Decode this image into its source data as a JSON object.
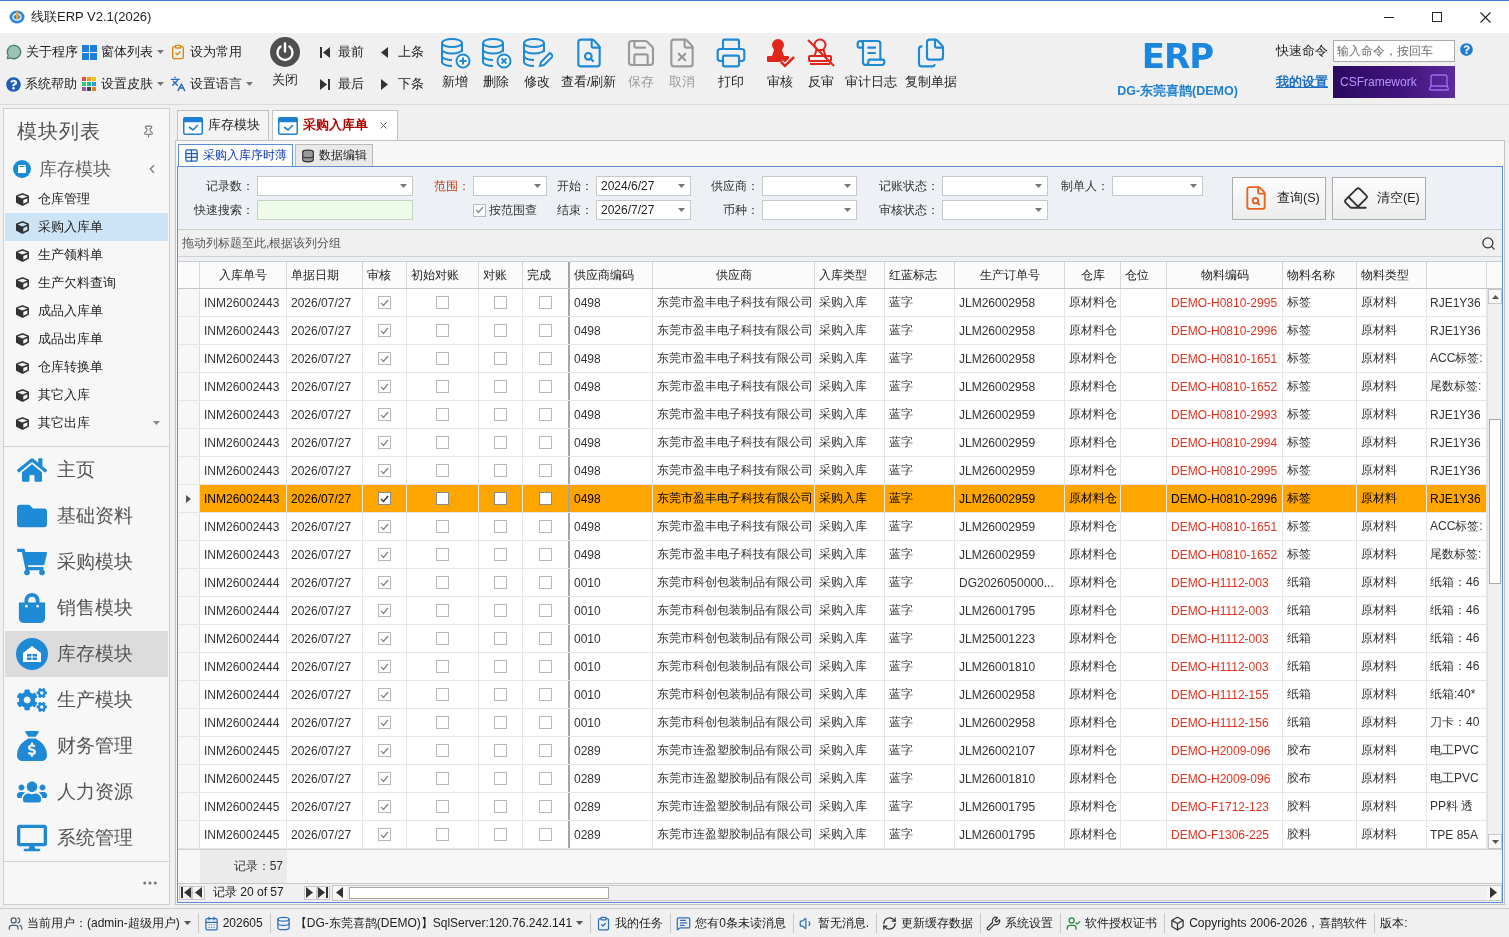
{
  "window": {
    "title": "线联ERP V2.1(2026)"
  },
  "toolbar": {
    "small_buttons": [
      {
        "label": "关于程序",
        "dropdown": false
      },
      {
        "label": "窗体列表",
        "dropdown": true
      },
      {
        "label": "设为常用",
        "dropdown": false
      },
      {
        "label": "系统帮助",
        "dropdown": false
      },
      {
        "label": "设置皮肤",
        "dropdown": true
      },
      {
        "label": "设置语言",
        "dropdown": true
      }
    ],
    "close_button": {
      "label": "关闭"
    },
    "nav_buttons": [
      {
        "label": "最前"
      },
      {
        "label": "上条"
      },
      {
        "label": "最后"
      },
      {
        "label": "下条"
      }
    ],
    "action_groups": [
      [
        {
          "label": "新增",
          "disabled": false
        },
        {
          "label": "删除",
          "disabled": false
        },
        {
          "label": "修改",
          "disabled": false
        },
        {
          "label": "查看/刷新",
          "disabled": false
        },
        {
          "label": "保存",
          "disabled": true
        },
        {
          "label": "取消",
          "disabled": true
        }
      ],
      [
        {
          "label": "打印",
          "disabled": false
        }
      ],
      [
        {
          "label": "审核",
          "disabled": false
        },
        {
          "label": "反审",
          "disabled": false
        },
        {
          "label": "审计日志",
          "disabled": false
        },
        {
          "label": "复制单据",
          "disabled": false
        }
      ]
    ],
    "logo": {
      "text": "ERP",
      "caption": "DG-东莞喜鹊(DEMO)"
    },
    "quick_command": {
      "label": "快速命令",
      "placeholder": "输入命令，按回车"
    },
    "settings_link": "我的设置",
    "banner": {
      "text": "CSFramework"
    }
  },
  "sidebar": {
    "title": "模块列表",
    "module": "库存模块",
    "items": [
      {
        "label": "仓库管理",
        "selected": false
      },
      {
        "label": "采购入库单",
        "selected": true
      },
      {
        "label": "生产领料单",
        "selected": false
      },
      {
        "label": "生产欠料查询",
        "selected": false
      },
      {
        "label": "成品入库单",
        "selected": false
      },
      {
        "label": "成品出库单",
        "selected": false
      },
      {
        "label": "仓库转换单",
        "selected": false
      },
      {
        "label": "其它入库",
        "selected": false
      },
      {
        "label": "其它出库",
        "selected": false
      }
    ],
    "groups": [
      {
        "label": "主页",
        "selected": false
      },
      {
        "label": "基础资料",
        "selected": false
      },
      {
        "label": "采购模块",
        "selected": false
      },
      {
        "label": "销售模块",
        "selected": false
      },
      {
        "label": "库存模块",
        "selected": true
      },
      {
        "label": "生产模块",
        "selected": false
      },
      {
        "label": "财务管理",
        "selected": false
      },
      {
        "label": "人力资源",
        "selected": false
      },
      {
        "label": "系统管理",
        "selected": false
      }
    ]
  },
  "tabs": [
    {
      "label": "库存模块",
      "selected": false,
      "closable": false
    },
    {
      "label": "采购入库单",
      "selected": true,
      "closable": true
    }
  ],
  "sub_tabs": [
    {
      "label": "采购入库序时薄",
      "selected": true
    },
    {
      "label": "数据编辑",
      "selected": false
    }
  ],
  "filters": {
    "rows": [
      [
        {
          "kind": "combo",
          "label": "记录数：",
          "highlight": false
        },
        {
          "kind": "combo",
          "label": "范围：",
          "highlight": true
        },
        {
          "kind": "combo",
          "label": "开始：",
          "value": "2024/6/27",
          "highlight": false
        },
        {
          "kind": "combo",
          "label": "供应商：",
          "highlight": false
        },
        {
          "kind": "combo",
          "label": "记账状态：",
          "highlight": false
        },
        {
          "kind": "combo",
          "label": "制单人：",
          "highlight": false
        }
      ],
      [
        {
          "kind": "input",
          "label": "快速搜索：",
          "highlight": false
        },
        {
          "kind": "checkbox",
          "label": "按范围查",
          "checked": true
        },
        {
          "kind": "combo",
          "label": "结束：",
          "value": "2026/7/27",
          "highlight": false
        },
        {
          "kind": "combo",
          "label": "币种：",
          "highlight": false
        },
        {
          "kind": "combo",
          "label": "审核状态：",
          "highlight": false
        }
      ]
    ],
    "buttons": [
      {
        "label": "查询(S)"
      },
      {
        "label": "清空(E)"
      }
    ]
  },
  "group_panel": {
    "hint": "拖动列标题至此,根据该列分组"
  },
  "table": {
    "columns": [
      {
        "label": "入库单号",
        "kind": "text"
      },
      {
        "label": "单据日期",
        "kind": "text"
      },
      {
        "label": "审核",
        "kind": "check"
      },
      {
        "label": "初始对账",
        "kind": "check"
      },
      {
        "label": "对账",
        "kind": "check"
      },
      {
        "label": "完成",
        "kind": "check"
      },
      {
        "label": "供应商编码",
        "kind": "text"
      },
      {
        "label": "供应商",
        "kind": "text"
      },
      {
        "label": "入库类型",
        "kind": "text"
      },
      {
        "label": "红蓝标志",
        "kind": "text"
      },
      {
        "label": "生产订单号",
        "kind": "text"
      },
      {
        "label": "仓库",
        "kind": "text"
      },
      {
        "label": "仓位",
        "kind": "text"
      },
      {
        "label": "物料编码",
        "kind": "code"
      },
      {
        "label": "物料名称",
        "kind": "text"
      },
      {
        "label": "物料类型",
        "kind": "text"
      },
      {
        "kind": "text"
      }
    ],
    "rows": [
      {
        "selected": false,
        "cells": [
          "INM26002443",
          "2026/07/27",
          {
            "checked": true
          },
          {
            "checked": false
          },
          {
            "checked": false
          },
          {
            "checked": false
          },
          "0498",
          "东莞市盈丰电子科技有限公司",
          "采购入库",
          "蓝字",
          "JLM26002958",
          "原材料仓",
          null,
          "DEMO-H0810-2995",
          "标签",
          "原材料",
          "RJE1Y36"
        ]
      },
      {
        "selected": false,
        "cells": [
          "INM26002443",
          "2026/07/27",
          {
            "checked": true
          },
          {
            "checked": false
          },
          {
            "checked": false
          },
          {
            "checked": false
          },
          "0498",
          "东莞市盈丰电子科技有限公司",
          "采购入库",
          "蓝字",
          "JLM26002958",
          "原材料仓",
          null,
          "DEMO-H0810-2996",
          "标签",
          "原材料",
          "RJE1Y36"
        ]
      },
      {
        "selected": false,
        "cells": [
          "INM26002443",
          "2026/07/27",
          {
            "checked": true
          },
          {
            "checked": false
          },
          {
            "checked": false
          },
          {
            "checked": false
          },
          "0498",
          "东莞市盈丰电子科技有限公司",
          "采购入库",
          "蓝字",
          "JLM26002958",
          "原材料仓",
          null,
          "DEMO-H0810-1651",
          "标签",
          "原材料",
          "ACC标签:"
        ]
      },
      {
        "selected": false,
        "cells": [
          "INM26002443",
          "2026/07/27",
          {
            "checked": true
          },
          {
            "checked": false
          },
          {
            "checked": false
          },
          {
            "checked": false
          },
          "0498",
          "东莞市盈丰电子科技有限公司",
          "采购入库",
          "蓝字",
          "JLM26002958",
          "原材料仓",
          null,
          "DEMO-H0810-1652",
          "标签",
          "原材料",
          "尾数标签:"
        ]
      },
      {
        "selected": false,
        "cells": [
          "INM26002443",
          "2026/07/27",
          {
            "checked": true
          },
          {
            "checked": false
          },
          {
            "checked": false
          },
          {
            "checked": false
          },
          "0498",
          "东莞市盈丰电子科技有限公司",
          "采购入库",
          "蓝字",
          "JLM26002959",
          "原材料仓",
          null,
          "DEMO-H0810-2993",
          "标签",
          "原材料",
          "RJE1Y36"
        ]
      },
      {
        "selected": false,
        "cells": [
          "INM26002443",
          "2026/07/27",
          {
            "checked": true
          },
          {
            "checked": false
          },
          {
            "checked": false
          },
          {
            "checked": false
          },
          "0498",
          "东莞市盈丰电子科技有限公司",
          "采购入库",
          "蓝字",
          "JLM26002959",
          "原材料仓",
          null,
          "DEMO-H0810-2994",
          "标签",
          "原材料",
          "RJE1Y36"
        ]
      },
      {
        "selected": false,
        "cells": [
          "INM26002443",
          "2026/07/27",
          {
            "checked": true
          },
          {
            "checked": false
          },
          {
            "checked": false
          },
          {
            "checked": false
          },
          "0498",
          "东莞市盈丰电子科技有限公司",
          "采购入库",
          "蓝字",
          "JLM26002959",
          "原材料仓",
          null,
          "DEMO-H0810-2995",
          "标签",
          "原材料",
          "RJE1Y36"
        ]
      },
      {
        "selected": true,
        "cells": [
          "INM26002443",
          "2026/07/27",
          {
            "checked": true
          },
          {
            "checked": false
          },
          {
            "checked": false
          },
          {
            "checked": false
          },
          "0498",
          "东莞市盈丰电子科技有限公司",
          "采购入库",
          "蓝字",
          "JLM26002959",
          "原材料仓",
          null,
          "DEMO-H0810-2996",
          "标签",
          "原材料",
          "RJE1Y36"
        ]
      },
      {
        "selected": false,
        "cells": [
          "INM26002443",
          "2026/07/27",
          {
            "checked": true
          },
          {
            "checked": false
          },
          {
            "checked": false
          },
          {
            "checked": false
          },
          "0498",
          "东莞市盈丰电子科技有限公司",
          "采购入库",
          "蓝字",
          "JLM26002959",
          "原材料仓",
          null,
          "DEMO-H0810-1651",
          "标签",
          "原材料",
          "ACC标签:"
        ]
      },
      {
        "selected": false,
        "cells": [
          "INM26002443",
          "2026/07/27",
          {
            "checked": true
          },
          {
            "checked": false
          },
          {
            "checked": false
          },
          {
            "checked": false
          },
          "0498",
          "东莞市盈丰电子科技有限公司",
          "采购入库",
          "蓝字",
          "JLM26002959",
          "原材料仓",
          null,
          "DEMO-H0810-1652",
          "标签",
          "原材料",
          "尾数标签:"
        ]
      },
      {
        "selected": false,
        "cells": [
          "INM26002444",
          "2026/07/27",
          {
            "checked": true
          },
          {
            "checked": false
          },
          {
            "checked": false
          },
          {
            "checked": false
          },
          "0010",
          "东莞市科创包装制品有限公司",
          "采购入库",
          "蓝字",
          "DG2026050000...",
          "原材料仓",
          null,
          "DEMO-H1112-003",
          "纸箱",
          "原材料",
          "纸箱：46"
        ]
      },
      {
        "selected": false,
        "cells": [
          "INM26002444",
          "2026/07/27",
          {
            "checked": true
          },
          {
            "checked": false
          },
          {
            "checked": false
          },
          {
            "checked": false
          },
          "0010",
          "东莞市科创包装制品有限公司",
          "采购入库",
          "蓝字",
          "JLM26001795",
          "原材料仓",
          null,
          "DEMO-H1112-003",
          "纸箱",
          "原材料",
          "纸箱：46"
        ]
      },
      {
        "selected": false,
        "cells": [
          "INM26002444",
          "2026/07/27",
          {
            "checked": true
          },
          {
            "checked": false
          },
          {
            "checked": false
          },
          {
            "checked": false
          },
          "0010",
          "东莞市科创包装制品有限公司",
          "采购入库",
          "蓝字",
          "JLM25001223",
          "原材料仓",
          null,
          "DEMO-H1112-003",
          "纸箱",
          "原材料",
          "纸箱：46"
        ]
      },
      {
        "selected": false,
        "cells": [
          "INM26002444",
          "2026/07/27",
          {
            "checked": true
          },
          {
            "checked": false
          },
          {
            "checked": false
          },
          {
            "checked": false
          },
          "0010",
          "东莞市科创包装制品有限公司",
          "采购入库",
          "蓝字",
          "JLM26001810",
          "原材料仓",
          null,
          "DEMO-H1112-003",
          "纸箱",
          "原材料",
          "纸箱：46"
        ]
      },
      {
        "selected": false,
        "cells": [
          "INM26002444",
          "2026/07/27",
          {
            "checked": true
          },
          {
            "checked": false
          },
          {
            "checked": false
          },
          {
            "checked": false
          },
          "0010",
          "东莞市科创包装制品有限公司",
          "采购入库",
          "蓝字",
          "JLM26002958",
          "原材料仓",
          null,
          "DEMO-H1112-155",
          "纸箱",
          "原材料",
          "纸箱:40*"
        ]
      },
      {
        "selected": false,
        "cells": [
          "INM26002444",
          "2026/07/27",
          {
            "checked": true
          },
          {
            "checked": false
          },
          {
            "checked": false
          },
          {
            "checked": false
          },
          "0010",
          "东莞市科创包装制品有限公司",
          "采购入库",
          "蓝字",
          "JLM26002958",
          "原材料仓",
          null,
          "DEMO-H1112-156",
          "纸箱",
          "原材料",
          "刀卡：40"
        ]
      },
      {
        "selected": false,
        "cells": [
          "INM26002445",
          "2026/07/27",
          {
            "checked": true
          },
          {
            "checked": false
          },
          {
            "checked": false
          },
          {
            "checked": false
          },
          "0289",
          "东莞市连盈塑胶制品有限公司",
          "采购入库",
          "蓝字",
          "JLM26002107",
          "原材料仓",
          null,
          "DEMO-H2009-096",
          "胶布",
          "原材料",
          "电工PVC"
        ]
      },
      {
        "selected": false,
        "cells": [
          "INM26002445",
          "2026/07/27",
          {
            "checked": true
          },
          {
            "checked": false
          },
          {
            "checked": false
          },
          {
            "checked": false
          },
          "0289",
          "东莞市连盈塑胶制品有限公司",
          "采购入库",
          "蓝字",
          "JLM26001810",
          "原材料仓",
          null,
          "DEMO-H2009-096",
          "胶布",
          "原材料",
          "电工PVC"
        ]
      },
      {
        "selected": false,
        "cells": [
          "INM26002445",
          "2026/07/27",
          {
            "checked": true
          },
          {
            "checked": false
          },
          {
            "checked": false
          },
          {
            "checked": false
          },
          "0289",
          "东莞市连盈塑胶制品有限公司",
          "采购入库",
          "蓝字",
          "JLM26001795",
          "原材料仓",
          null,
          "DEMO-F1712-123",
          "胶料",
          "原材料",
          "PP料 透"
        ]
      },
      {
        "selected": false,
        "cells": [
          "INM26002445",
          "2026/07/27",
          {
            "checked": true
          },
          {
            "checked": false
          },
          {
            "checked": false
          },
          {
            "checked": false
          },
          "0289",
          "东莞市连盈塑胶制品有限公司",
          "采购入库",
          "蓝字",
          "JLM26001795",
          "原材料仓",
          null,
          "DEMO-F1306-225",
          "胶料",
          "原材料",
          "TPE 85A"
        ]
      }
    ],
    "footer": {
      "summary": "记录：57"
    },
    "navigator": {
      "text": "记录 20 of 57"
    }
  },
  "status_bar": [
    {
      "label": "当前用户：(admin-超级用户)",
      "dropdown": true
    },
    {
      "label": "202605",
      "dropdown": false
    },
    {
      "label": "【DG-东莞喜鹊(DEMO)】SqlServer:120.76.242.141",
      "dropdown": true
    },
    {
      "label": "我的任务",
      "dropdown": false
    },
    {
      "label": "您有0条未读消息",
      "dropdown": false
    },
    {
      "label": "暂无消息.",
      "dropdown": false
    },
    {
      "label": "更新缓存数据",
      "dropdown": false
    },
    {
      "label": "系统设置",
      "dropdown": false
    },
    {
      "label": "软件授权证书",
      "dropdown": false
    },
    {
      "label": "Copyrights 2006-2026，喜鹊软件",
      "dropdown": false
    },
    {
      "label": "版本:",
      "dropdown": false
    }
  ]
}
